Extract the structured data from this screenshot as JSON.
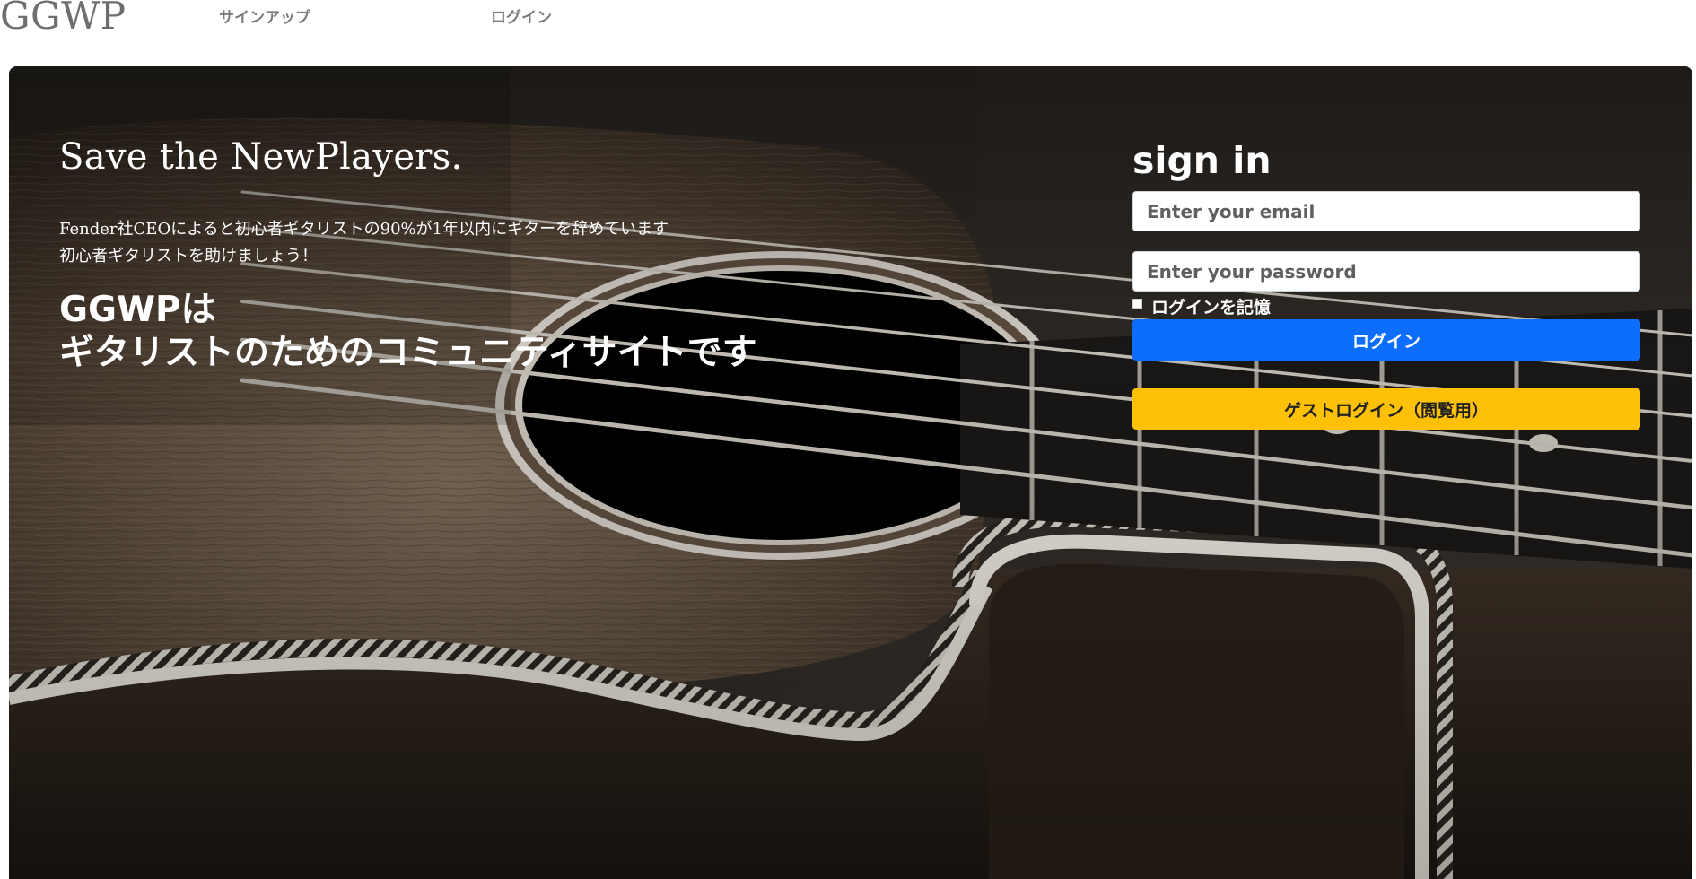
{
  "nav": {
    "brand": "GGWP",
    "signup": "サインアップ",
    "login": "ログイン"
  },
  "hero": {
    "tagline": "Save the NewPlayers.",
    "stat_line_1": "Fender社CEOによると初心者ギタリストの90%が1年以内にギターを辞めています",
    "stat_line_2": "初心者ギタリストを助けましょう！",
    "headline_1": "GGWPは",
    "headline_2": "ギタリストのためのコミュニティサイトです"
  },
  "signin": {
    "title": "sign in",
    "email_placeholder": "Enter your email",
    "password_placeholder": "Enter your password",
    "remember_label": "ログインを記憶",
    "remember_checked": false,
    "login_button": "ログイン",
    "guest_button": "ゲストログイン（閲覧用）"
  },
  "colors": {
    "primary": "#0d6efd",
    "warning": "#ffc107",
    "nav_text": "#7a7a7a"
  }
}
